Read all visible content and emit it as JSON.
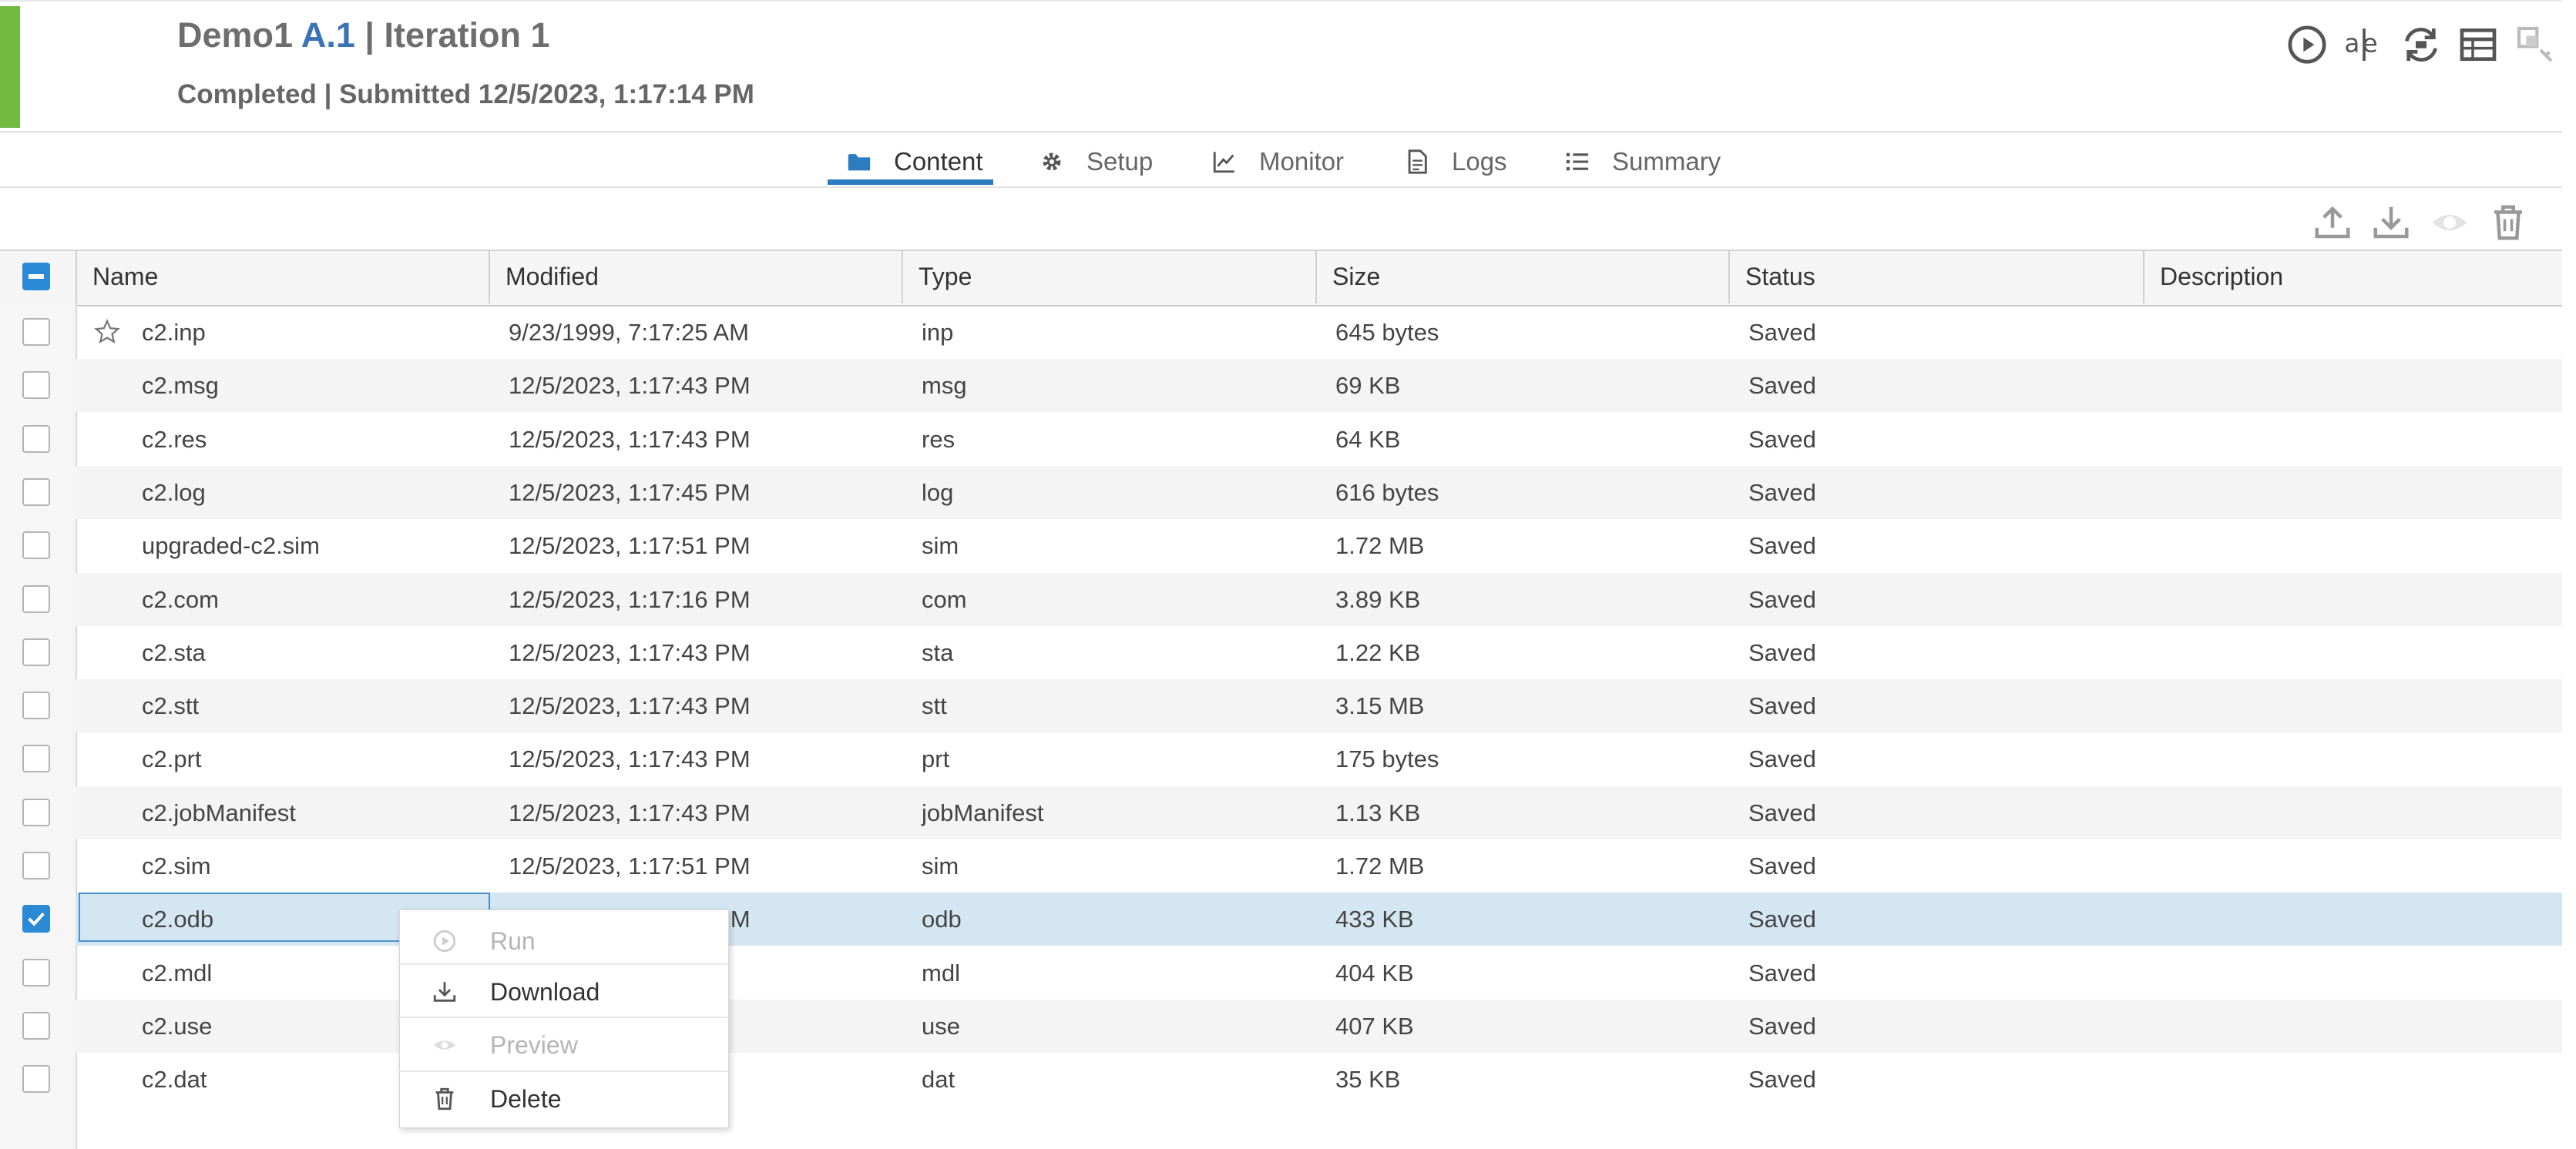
{
  "header": {
    "title_prefix": "Demo1 ",
    "title_highlight": "A.1",
    "title_suffix": " | Iteration 1",
    "status_line": "Completed | Submitted 12/5/2023, 1:17:14 PM",
    "accent_color": "#71bb43",
    "icons": [
      "run-circle-icon",
      "spell-check-icon",
      "sync-icon",
      "table-view-icon",
      "keys-icon"
    ]
  },
  "tabs": [
    {
      "label": "Content",
      "icon": "folder-icon",
      "active": true
    },
    {
      "label": "Setup",
      "icon": "gear-icon",
      "active": false
    },
    {
      "label": "Monitor",
      "icon": "line-chart-icon",
      "active": false
    },
    {
      "label": "Logs",
      "icon": "document-icon",
      "active": false
    },
    {
      "label": "Summary",
      "icon": "list-icon",
      "active": false
    }
  ],
  "toolbar": {
    "icons": [
      "upload-icon",
      "download-icon",
      "preview-eye-icon",
      "trash-icon"
    ]
  },
  "table": {
    "columns": [
      "Name",
      "Modified",
      "Type",
      "Size",
      "Status",
      "Description"
    ],
    "rows": [
      {
        "name": "c2.inp",
        "modified": "9/23/1999, 7:17:25 AM",
        "type": "inp",
        "size": "645 bytes",
        "status": "Saved",
        "starred": true
      },
      {
        "name": "c2.msg",
        "modified": "12/5/2023, 1:17:43 PM",
        "type": "msg",
        "size": "69 KB",
        "status": "Saved"
      },
      {
        "name": "c2.res",
        "modified": "12/5/2023, 1:17:43 PM",
        "type": "res",
        "size": "64 KB",
        "status": "Saved"
      },
      {
        "name": "c2.log",
        "modified": "12/5/2023, 1:17:45 PM",
        "type": "log",
        "size": "616 bytes",
        "status": "Saved"
      },
      {
        "name": "upgraded-c2.sim",
        "modified": "12/5/2023, 1:17:51 PM",
        "type": "sim",
        "size": "1.72 MB",
        "status": "Saved"
      },
      {
        "name": "c2.com",
        "modified": "12/5/2023, 1:17:16 PM",
        "type": "com",
        "size": "3.89 KB",
        "status": "Saved"
      },
      {
        "name": "c2.sta",
        "modified": "12/5/2023, 1:17:43 PM",
        "type": "sta",
        "size": "1.22 KB",
        "status": "Saved"
      },
      {
        "name": "c2.stt",
        "modified": "12/5/2023, 1:17:43 PM",
        "type": "stt",
        "size": "3.15 MB",
        "status": "Saved"
      },
      {
        "name": "c2.prt",
        "modified": "12/5/2023, 1:17:43 PM",
        "type": "prt",
        "size": "175 bytes",
        "status": "Saved"
      },
      {
        "name": "c2.jobManifest",
        "modified": "12/5/2023, 1:17:43 PM",
        "type": "jobManifest",
        "size": "1.13 KB",
        "status": "Saved"
      },
      {
        "name": "c2.sim",
        "modified": "12/5/2023, 1:17:51 PM",
        "type": "sim",
        "size": "1.72 MB",
        "status": "Saved"
      },
      {
        "name": "c2.odb",
        "modified": "12/5/2023, 1:17:43 PM",
        "type": "odb",
        "size": "433 KB",
        "status": "Saved",
        "selected": true
      },
      {
        "name": "c2.mdl",
        "modified": "PM",
        "type": "mdl",
        "size": "404 KB",
        "status": "Saved"
      },
      {
        "name": "c2.use",
        "modified": "PM",
        "type": "use",
        "size": "407 KB",
        "status": "Saved"
      },
      {
        "name": "c2.dat",
        "modified": "PM",
        "type": "dat",
        "size": "35 KB",
        "status": "Saved"
      }
    ]
  },
  "context_menu": {
    "items": [
      {
        "label": "Run",
        "icon": "run-icon",
        "enabled": false
      },
      {
        "label": "Download",
        "icon": "download-icon",
        "enabled": true
      },
      {
        "label": "Preview",
        "icon": "eye-icon",
        "enabled": false
      },
      {
        "label": "Delete",
        "icon": "trash-icon",
        "enabled": true
      }
    ]
  },
  "colors": {
    "selected_row": "#d4e6f2",
    "checkbox_checked": "#2b8ad6",
    "tab_underline": "#2b7cc1"
  }
}
